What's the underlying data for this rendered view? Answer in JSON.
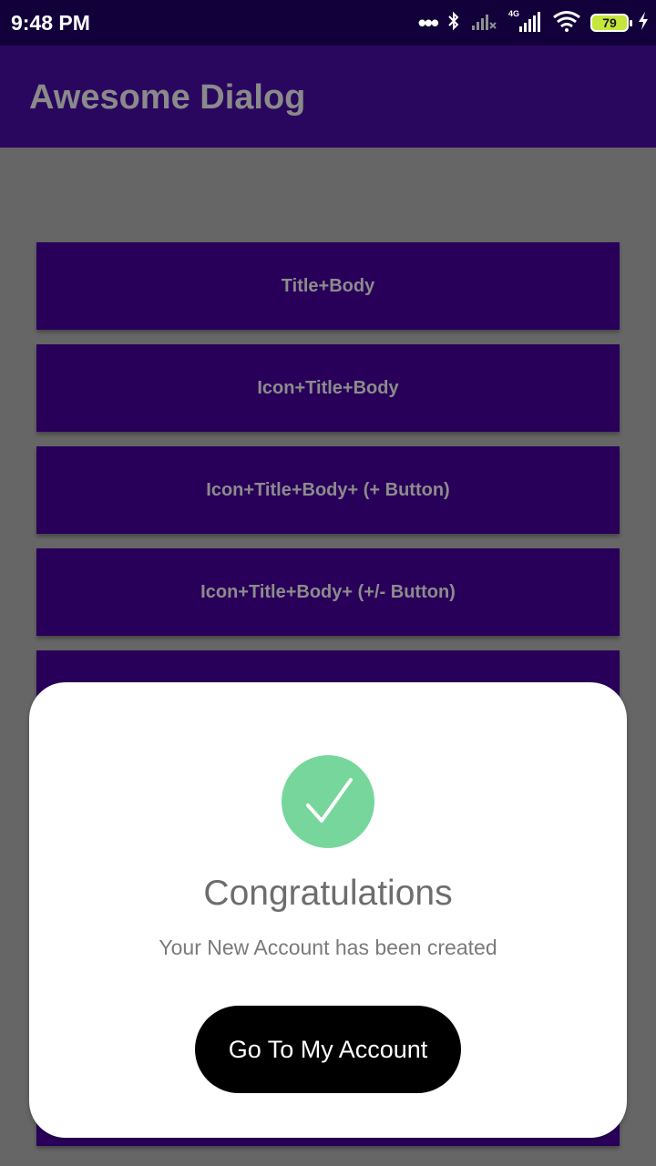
{
  "status_bar": {
    "time": "9:48 PM",
    "icons": [
      "dots-icon",
      "bluetooth-icon",
      "signal-muted-icon",
      "signal-4g-icon",
      "wifi-icon",
      "battery-icon",
      "charging-icon"
    ],
    "network_label": "4G",
    "battery_level": "79"
  },
  "app_bar": {
    "title": "Awesome Dialog",
    "background_color": "#2a075f"
  },
  "buttons": [
    {
      "label": "Title+Body"
    },
    {
      "label": "Icon+Title+Body"
    },
    {
      "label": "Icon+Title+Body+ (+ Button)"
    },
    {
      "label": "Icon+Title+Body+ (+/- Button)"
    },
    {
      "label": ""
    }
  ],
  "dialog": {
    "icon": "check-icon",
    "icon_color": "#77d69c",
    "title": "Congratulations",
    "body": "Your New Account has been created",
    "button_label": "Go To My Account"
  }
}
